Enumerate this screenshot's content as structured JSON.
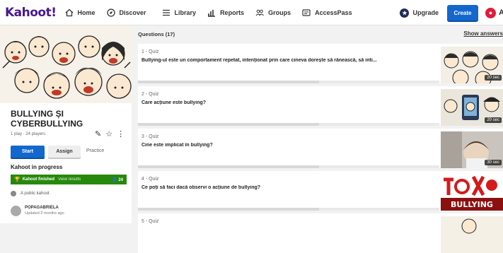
{
  "nav": {
    "logo": "Kahoot!",
    "items": [
      {
        "label": "Home",
        "icon": "home-icon"
      },
      {
        "label": "Discover",
        "icon": "compass-icon"
      },
      {
        "label": "Library",
        "icon": "list-icon"
      },
      {
        "label": "Reports",
        "icon": "bar-chart-icon"
      },
      {
        "label": "Groups",
        "icon": "people-icon"
      },
      {
        "label": "AccessPass",
        "icon": "pass-icon"
      }
    ],
    "upgrade": "Upgrade",
    "create": "Create"
  },
  "kahoot": {
    "title": "BULLYING ȘI CYBERBULLYING",
    "meta": "1 play · 24 players",
    "start": "Start",
    "assign": "Assign",
    "practice": "Practice",
    "progress_label": "Kahoot in progress",
    "finished_label": "Kahoot finished",
    "view_results": "View results",
    "players_count": "24",
    "visibility": "A public kahoot",
    "owner": "POPAGABRIELA",
    "updated": "Updated 2 months ago"
  },
  "questions": {
    "header": "Questions (17)",
    "show_answers": "Show answers",
    "items": [
      {
        "num": "1 - Quiz",
        "text": "Bullying-ul este un comportament repetat, intenționat prin care cineva dorește să rănească, să inti...",
        "timer": "20 sec"
      },
      {
        "num": "2 - Quiz",
        "text": "Care acțiune este bullying?",
        "timer": "20 sec"
      },
      {
        "num": "3 - Quiz",
        "text": "Cine este implicat în bullying?",
        "timer": "30 sec"
      },
      {
        "num": "4 - Quiz",
        "text": "Ce poți să faci dacă observi o acțiune de bullying?",
        "timer": ""
      },
      {
        "num": "5 - Quiz",
        "text": "",
        "timer": ""
      }
    ]
  },
  "colors": {
    "brand": "#46178f",
    "primary": "#1368ce",
    "success": "#26890c",
    "danger": "#e21b3c"
  }
}
